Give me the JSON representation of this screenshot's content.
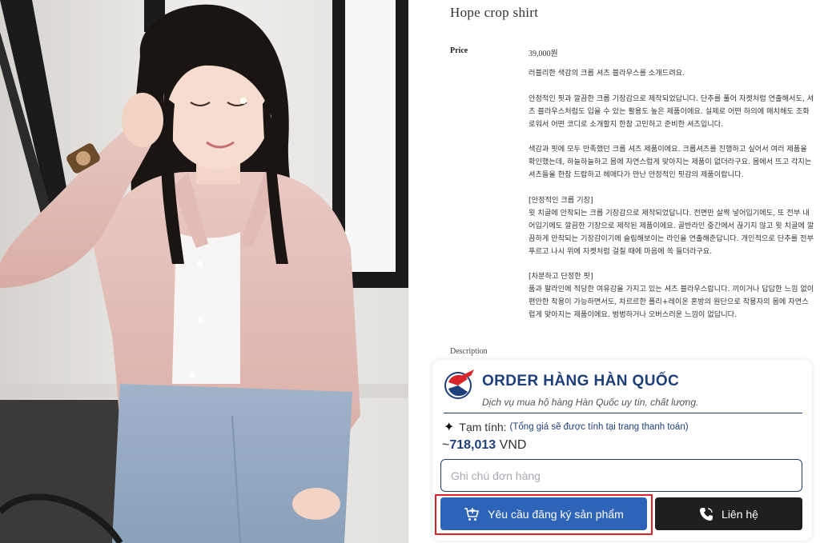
{
  "product": {
    "title": "Hope crop shirt",
    "price_label": "Price",
    "price": "39,000원",
    "description_label": "Description",
    "description_paragraphs": [
      "러블리한 색감의 크롭 셔츠 블라우스를 소개드려요.",
      "안정적인 핏과 깔끔한 크롭 기장감으로 제작되었답니다. 단추를 풀어 자켓처럼 연출해서도, 셔츠 블라우스처럼도 입을 수 있는 활용도 높은 제품이에요. 실제로 어떤 하의에 매치해도 조화로워서 어떤 코디로 소개할지 한참 고민하고 준비한 셔츠입니다.",
      "색감과 핏에 모두 만족했던 크롭 셔츠 제품이에요. 크롭셔츠를 진행하고 싶어서 여러 제품을 확인했는데, 하늘하늘하고 몸에 자연스럽게 맞아지는 제품이 없더라구요. 몸에서 뜨고 각지는 셔츠들을 한참 드랍하고 헤매다가 만난 안정적인 핏감의 제품이랍니다.",
      "[안정적인 크롭 기장]\n윗 치골에 안착되는 크롭 기장감으로 제작되었답니다. 전면만 살짝 넣어입기에도, 또 전부 내어입기에도 깔끔한 기장으로 제작된 제품이에요. 골반라인 중간에서 끊기지 않고 윗 치골에 깔끔하게 안착되는 기장감이기에 슬림해보이는 라인을 연출해준답니다. 개인적으로 단추를 전부 푸르고 나시 위에 자켓처럼 걸칠 때에 마음에 쏙 들더라구요.",
      "[차분하고 단정한 핏]\n품과 팔라인에 적당한 여유감을 가지고 있는 셔츠 블라우스랍니다. 끼이거나 답답한 느낌 없이 편안한 착용이 가능하면서도, 차르르한 폴리+레이온 혼방의 원단으로 착용자의 몸에 자연스럽게 맞아지는 제품이에요. 벙벙하거나 오버스러운 느낌이 없답니다."
    ]
  },
  "order_widget": {
    "brand": "ORDER HÀNG HÀN QUỐC",
    "tagline": "Dịch vụ mua hộ hàng Hàn Quốc uy tín, chất lượng.",
    "subtotal_label": "Tạm tính:",
    "subtotal_note": "(Tổng giá sẽ được tính tại trang thanh toán)",
    "approx_symbol": "~",
    "total_value": "718,013",
    "currency": "VND",
    "note_placeholder": "Ghi chú đơn hàng",
    "note_value": "",
    "register_button": "Yêu cầu đăng ký sản phẩm",
    "contact_button": "Liên hệ",
    "icons": [
      "sparkle-icon",
      "cart-icon",
      "phone-icon"
    ]
  },
  "colors": {
    "brand_navy": "#1e3f7a",
    "button_blue": "#2e64b8",
    "button_dark": "#1f1f1f",
    "highlight_red": "#e0202a"
  }
}
